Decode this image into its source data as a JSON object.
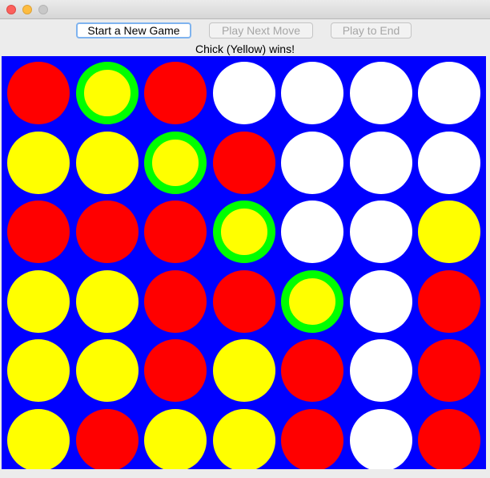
{
  "window": {
    "traffic_lights": [
      "close",
      "minimize",
      "zoom"
    ]
  },
  "toolbar": {
    "new_game_label": "Start a New Game",
    "next_move_label": "Play Next Move",
    "play_to_end_label": "Play to End"
  },
  "status": {
    "message": "Chick (Yellow) wins!"
  },
  "colors": {
    "board": "#0000ff",
    "red": "#ff0000",
    "yellow": "#ffff00",
    "empty": "#ffffff",
    "win_ring": "#00ff00"
  },
  "board": {
    "rows": 6,
    "columns": 7,
    "cells": [
      [
        "red",
        "yellow",
        "red",
        "empty",
        "empty",
        "empty",
        "empty"
      ],
      [
        "yellow",
        "yellow",
        "yellow",
        "red",
        "empty",
        "empty",
        "empty"
      ],
      [
        "red",
        "red",
        "red",
        "yellow",
        "empty",
        "empty",
        "yellow"
      ],
      [
        "yellow",
        "yellow",
        "red",
        "red",
        "yellow",
        "empty",
        "red"
      ],
      [
        "yellow",
        "yellow",
        "red",
        "yellow",
        "red",
        "empty",
        "red"
      ],
      [
        "yellow",
        "red",
        "yellow",
        "yellow",
        "red",
        "empty",
        "red"
      ]
    ],
    "winning_cells": [
      [
        0,
        1
      ],
      [
        1,
        2
      ],
      [
        2,
        3
      ],
      [
        3,
        4
      ]
    ]
  }
}
